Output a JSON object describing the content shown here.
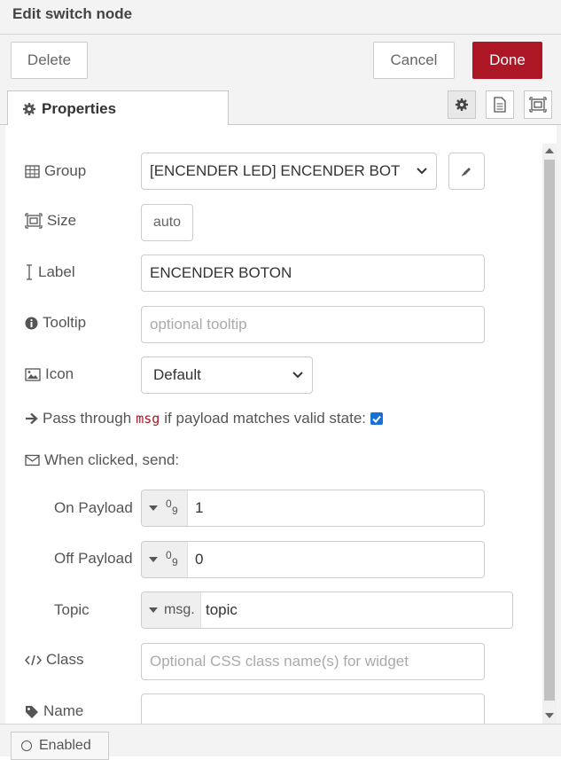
{
  "window": {
    "title": "Edit switch node"
  },
  "toolbar": {
    "delete_label": "Delete",
    "cancel_label": "Cancel",
    "done_label": "Done",
    "done_color": "#ad1625"
  },
  "tabs": {
    "properties_label": "Properties",
    "icons": [
      "gear-icon",
      "description-icon",
      "appearance-icon"
    ]
  },
  "form": {
    "group": {
      "label": "Group",
      "value": "[ENCENDER LED] ENCENDER BOT",
      "icon": "table-icon"
    },
    "size": {
      "label": "Size",
      "value": "auto",
      "icon": "size-icon"
    },
    "label": {
      "label": "Label",
      "value": "ENCENDER BOTON",
      "icon": "text-cursor-icon"
    },
    "tooltip": {
      "label": "Tooltip",
      "placeholder": "optional tooltip",
      "icon": "info-icon"
    },
    "icon": {
      "label": "Icon",
      "value": "Default",
      "icon": "image-icon"
    },
    "passthrough": {
      "text_before": "Pass through",
      "code": "msg",
      "text_after": "if payload matches valid state:",
      "checked": true
    },
    "when_clicked": {
      "label": "When clicked, send:",
      "icon": "envelope-icon"
    },
    "on_payload": {
      "label": "On Payload",
      "type": "number",
      "value": "1"
    },
    "off_payload": {
      "label": "Off Payload",
      "type": "number",
      "value": "0"
    },
    "topic": {
      "label": "Topic",
      "prefix": "msg.",
      "value": "topic"
    },
    "class": {
      "label": "Class",
      "placeholder": "Optional CSS class name(s) for widget",
      "icon": "code-icon"
    },
    "name": {
      "label": "Name",
      "value": "",
      "icon": "tag-icon"
    }
  },
  "footer": {
    "enabled_label": "Enabled"
  },
  "colors": {
    "accent": "#ad1625",
    "checkbox": "#1670d8",
    "panel": "#f3f3f3"
  }
}
